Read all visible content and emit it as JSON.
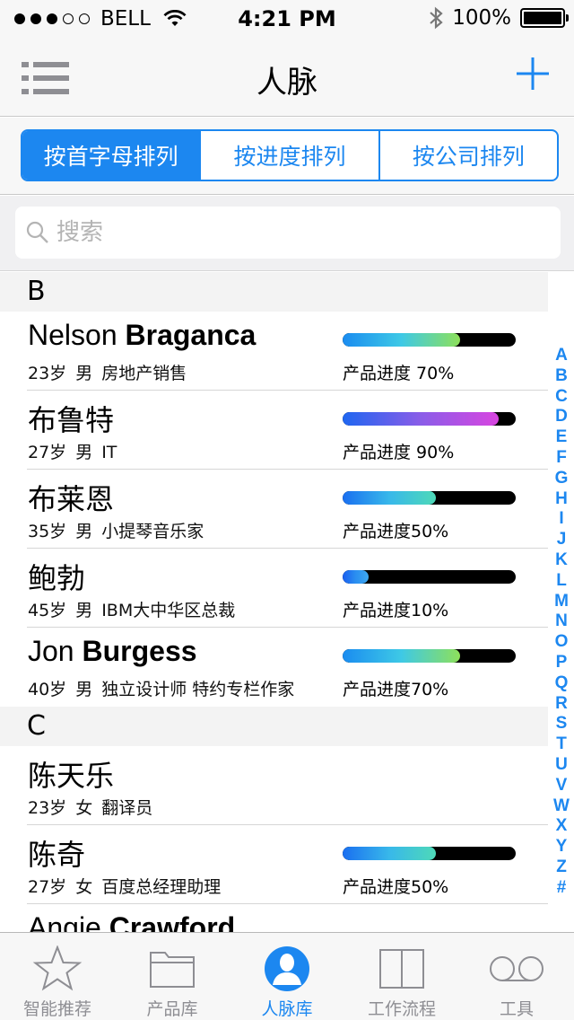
{
  "status": {
    "carrier": "BELL",
    "time": "4:21 PM",
    "battery": "100%"
  },
  "nav": {
    "title": "人脉",
    "menu_icon": "list-icon",
    "add_icon": "plus-icon"
  },
  "segments": [
    {
      "label": "按首字母排列",
      "active": true
    },
    {
      "label": "按进度排列",
      "active": false
    },
    {
      "label": "按公司排列",
      "active": false
    }
  ],
  "search": {
    "placeholder": "搜索",
    "value": ""
  },
  "sections": [
    {
      "letter": "B",
      "contacts": [
        {
          "name_first": "Nelson ",
          "name_last": "Braganca",
          "age": "23岁",
          "gender": "男",
          "title": "房地产销售",
          "progress_label": "产品进度  70%",
          "progress": 0.68,
          "gradient": [
            "#1a8cf0",
            "#3ec9e6",
            "#8ee05a"
          ]
        },
        {
          "name_first": "布鲁特",
          "name_last": "",
          "age": "27岁",
          "gender": "男",
          "title": "IT",
          "progress_label": "产品进度  90%",
          "progress": 0.9,
          "gradient": [
            "#1f66f0",
            "#8a5de8",
            "#d845e0"
          ]
        },
        {
          "name_first": "布莱恩",
          "name_last": "",
          "age": "35岁",
          "gender": "男",
          "title": "小提琴音乐家",
          "progress_label": "产品进度50%",
          "progress": 0.54,
          "gradient": [
            "#1a6ff0",
            "#38b8ea",
            "#4ed9b8"
          ]
        },
        {
          "name_first": "鲍勃",
          "name_last": "",
          "age": "45岁",
          "gender": "男",
          "title": "IBM大中华区总裁",
          "progress_label": "产品进度10%",
          "progress": 0.15,
          "gradient": [
            "#1a5ff0",
            "#2a8ef0",
            "#3ea8f0"
          ]
        },
        {
          "name_first": "Jon ",
          "name_last": "Burgess",
          "age": "40岁",
          "gender": "男",
          "title": "独立设计师  特约专栏作家",
          "progress_label": "产品进度70%",
          "progress": 0.68,
          "gradient": [
            "#1a8cf0",
            "#3ec9e6",
            "#8ee05a"
          ]
        }
      ]
    },
    {
      "letter": "C",
      "contacts": [
        {
          "name_first": "陈天乐",
          "name_last": "",
          "age": "23岁",
          "gender": "女",
          "title": "翻译员",
          "progress_label": "",
          "progress": null,
          "gradient": []
        },
        {
          "name_first": "陈奇",
          "name_last": "",
          "age": "27岁",
          "gender": "女",
          "title": "百度总经理助理",
          "progress_label": "产品进度50%",
          "progress": 0.54,
          "gradient": [
            "#1a6ff0",
            "#38b8ea",
            "#4ed9b8"
          ]
        },
        {
          "name_first": "Angie ",
          "name_last": "Crawford",
          "age": "",
          "gender": "",
          "title": "",
          "progress_label": "",
          "progress": null,
          "gradient": []
        }
      ]
    }
  ],
  "index_letters": [
    "A",
    "B",
    "C",
    "D",
    "E",
    "F",
    "G",
    "H",
    "I",
    "J",
    "K",
    "L",
    "M",
    "N",
    "O",
    "P",
    "Q",
    "R",
    "S",
    "T",
    "U",
    "V",
    "W",
    "X",
    "Y",
    "Z",
    "#"
  ],
  "tabs": [
    {
      "label": "智能推荐",
      "icon": "star-icon",
      "active": false
    },
    {
      "label": "产品库",
      "icon": "folder-icon",
      "active": false
    },
    {
      "label": "人脉库",
      "icon": "person-icon",
      "active": true
    },
    {
      "label": "工作流程",
      "icon": "book-icon",
      "active": false
    },
    {
      "label": "工具",
      "icon": "voicemail-icon",
      "active": false
    }
  ],
  "colors": {
    "accent": "#1c87f0",
    "tab_inactive": "#8e8e93"
  }
}
